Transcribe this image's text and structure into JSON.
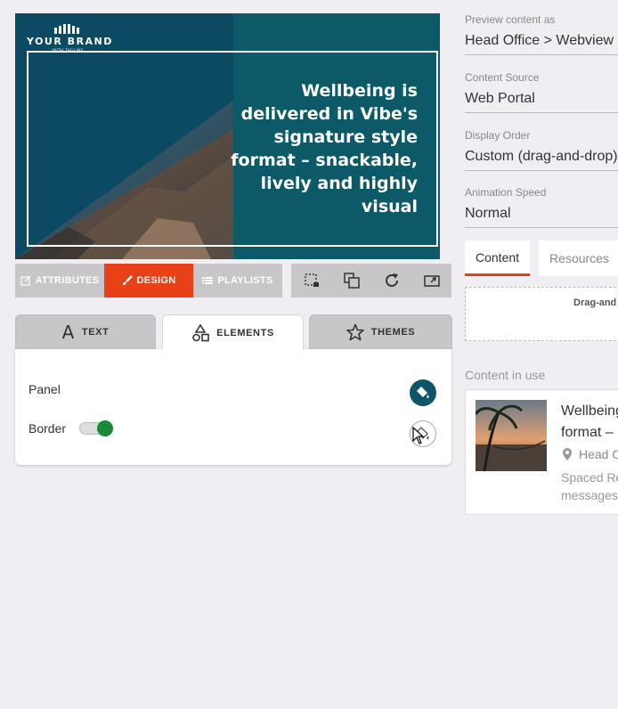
{
  "preview": {
    "brand_name": "YOUR BRAND",
    "brand_tagline": "WITH TAGLINE",
    "headline": "Wellbeing is delivered in Vibe's signature style format – snackable, lively and highly visual"
  },
  "toolbar": {
    "tabs": [
      {
        "label": "ATTRIBUTES",
        "icon": "edit-icon"
      },
      {
        "label": "DESIGN",
        "icon": "brush-icon",
        "active": true
      },
      {
        "label": "PLAYLISTS",
        "icon": "list-icon"
      }
    ],
    "tools": [
      "crop-icon",
      "layers-icon",
      "refresh-icon",
      "resize-icon"
    ],
    "accent": "#e84118"
  },
  "panel_tabs": {
    "text": "TEXT",
    "elements": "ELEMENTS",
    "themes": "THEMES"
  },
  "elements": {
    "panel_label": "Panel",
    "border_label": "Border",
    "border_enabled": true
  },
  "sidebar": {
    "preview_as": {
      "label": "Preview content as",
      "value": "Head Office > Webview"
    },
    "content_source": {
      "label": "Content Source",
      "value": "Web Portal"
    },
    "display_order": {
      "label": "Display Order",
      "value": "Custom (drag-and-drop)"
    },
    "animation_speed": {
      "label": "Animation Speed",
      "value": "Normal"
    },
    "tabs": [
      "Content",
      "Resources"
    ],
    "dropzone_text": "Drag-and",
    "in_use_label": "Content in use",
    "card": {
      "title_line1": "Wellbeing",
      "title_line2": "format –",
      "location": "Head O",
      "desc_line1": "Spaced Re",
      "desc_line2": "messages"
    }
  }
}
